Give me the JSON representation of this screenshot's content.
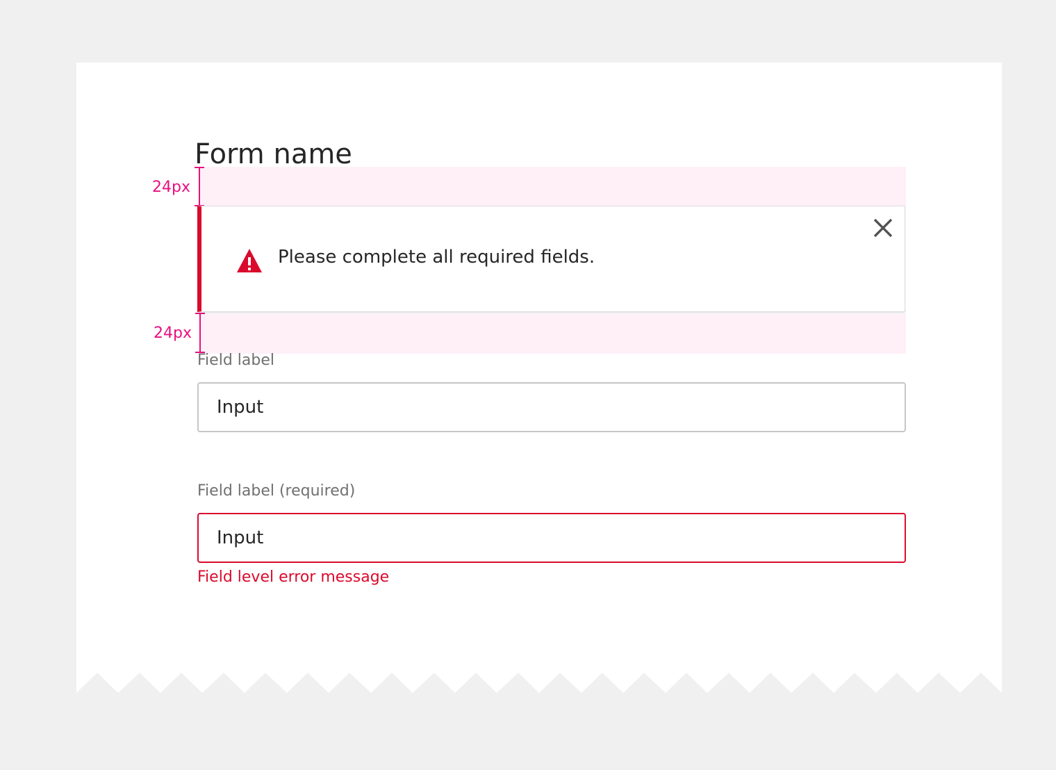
{
  "form": {
    "title": "Form name"
  },
  "spacing": {
    "top_label": "24px",
    "bottom_label": "24px"
  },
  "notification": {
    "type": "error",
    "message": "Please complete all required fields.",
    "icon": "warning-triangle-icon",
    "close_icon": "close-icon"
  },
  "fields": [
    {
      "label": "Field label",
      "value": "Input",
      "state": "default"
    },
    {
      "label": "Field label (required)",
      "value": "Input",
      "state": "error",
      "error_message": "Field level error message"
    }
  ],
  "colors": {
    "page_background": "#f0f0f0",
    "card": "#ffffff",
    "error": "#da0a2c",
    "annotation": "#e8117f",
    "spacing_highlight": "#fff0f8",
    "text": "#262626",
    "label": "#707070",
    "input_border": "#c6c6c6"
  }
}
